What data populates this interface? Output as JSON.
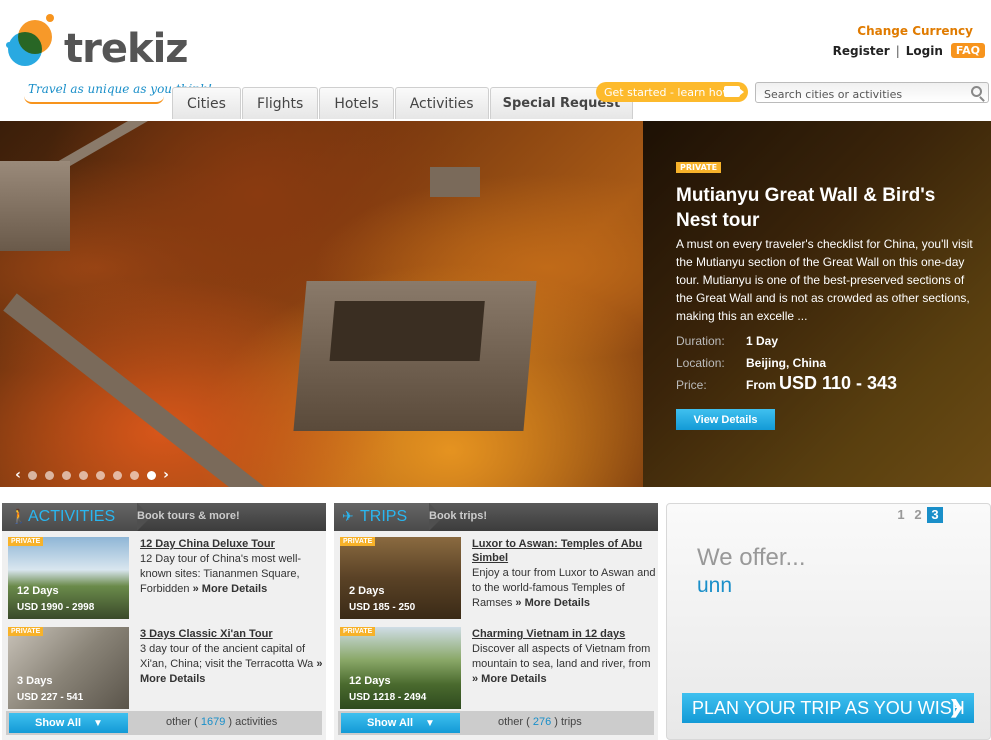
{
  "brand": {
    "name": "trekiz",
    "tagline": "Travel as unique as you think!"
  },
  "account": {
    "change_currency": "Change Currency",
    "register": "Register",
    "sep": "|",
    "login": "Login",
    "faq": "FAQ"
  },
  "nav": {
    "tabs": [
      "Cities",
      "Flights",
      "Hotels",
      "Activities",
      "Special Request"
    ]
  },
  "get_started": "Get started - learn how",
  "search": {
    "placeholder": "Search cities or activities"
  },
  "hero": {
    "badge": "PRIVATE",
    "title": "Mutianyu Great Wall & Bird's Nest tour",
    "description": "A must on every traveler's checklist for China, you'll visit the Mutianyu section of the Great Wall on this one-day tour. Mutianyu is one of the best-preserved sections of the Great Wall and is not as crowded as other sections, making this an excelle ...",
    "duration_label": "Duration:",
    "duration": "1 Day",
    "location_label": "Location:",
    "location": "Beijing, China",
    "price_label": "Price:",
    "price_from": "From",
    "price": "USD 110 - 343",
    "view_details": "View Details",
    "slider": {
      "prev": "‹",
      "next": "›",
      "dots": 8,
      "active_index": 7
    }
  },
  "activities": {
    "title": "ACTIVITIES",
    "subtitle": "Book tours & more!",
    "items": [
      {
        "badge": "PRIVATE",
        "days": "12 Days",
        "price": "USD 1990 - 2998",
        "title": "12 Day China Deluxe Tour",
        "desc": "12 Day tour of China's most well-known sites: Tiananmen Square, Forbidden",
        "more": "» More Details"
      },
      {
        "badge": "PRIVATE",
        "days": "3 Days",
        "price": "USD 227 - 541",
        "title": "3 Days Classic Xi'an Tour",
        "desc": "3 day tour of the ancient capital of Xi'an, China; visit the Terracotta Wa",
        "more": "» More Details"
      }
    ],
    "show_all": "Show All",
    "other_prefix": "other (",
    "other_count": "1679",
    "other_suffix": ") activities"
  },
  "trips": {
    "title": "TRIPS",
    "subtitle": "Book trips!",
    "items": [
      {
        "badge": "PRIVATE",
        "days": "2 Days",
        "price": "USD 185 - 250",
        "title": "Luxor to Aswan: Temples of Abu Simbel",
        "desc": "Enjoy a tour from Luxor to Aswan and to the world-famous Temples of Ramses",
        "more": "» More Details"
      },
      {
        "badge": "PRIVATE",
        "days": "12 Days",
        "price": "USD 1218 - 2494",
        "title": "Charming Vietnam in 12 days",
        "desc": "Discover all aspects of Vietnam from mountain to sea, land and river, from",
        "more": "» More Details"
      }
    ],
    "show_all": "Show All",
    "other_prefix": "other (",
    "other_count": "276",
    "other_suffix": ") trips"
  },
  "promo": {
    "pages": [
      "1",
      "2",
      "3"
    ],
    "active_page": "3",
    "heading": "We offer...",
    "word": "unn",
    "button": "PLAN YOUR TRIP AS YOU WISH"
  },
  "colors": {
    "accent_blue": "#29b6f0",
    "accent_orange": "#f7941d"
  }
}
